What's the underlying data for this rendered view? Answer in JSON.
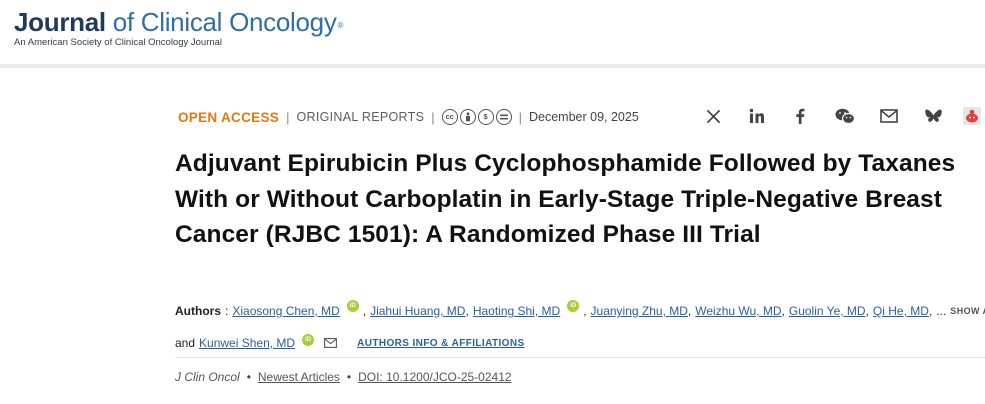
{
  "header": {
    "logo_journal": "Journal",
    "logo_rest": "of Clinical Oncology",
    "logo_mark": "®",
    "logo_subtitle": "An American Society of Clinical Oncology Journal"
  },
  "meta": {
    "access_label": "OPEN ACCESS",
    "section_label": "ORIGINAL REPORTS",
    "license_icons": [
      "cc",
      "by",
      "nc",
      "nd"
    ],
    "date": "December 09, 2025"
  },
  "share_icons": [
    "x-icon",
    "linkedin-icon",
    "facebook-icon",
    "wechat-icon",
    "email-icon",
    "bluesky-icon",
    "reddit-icon"
  ],
  "article": {
    "title": "Adjuvant Epirubicin Plus Cyclophosphamide Followed by Taxanes With or Without Carboplatin in Early-Stage Triple-Negative Breast Cancer (RJBC 1501): A Randomized Phase III Trial"
  },
  "authors": {
    "label": "Authors",
    "list": [
      "Xiaosong Chen, MD",
      "Jiahui Huang, MD",
      "Haoting Shi, MD",
      "Juanying Zhu, MD",
      "Weizhu Wu, MD",
      "Guolin Ye, MD",
      "Qi He, MD"
    ],
    "ellipsis": "...",
    "show_all": "SHOW ALL",
    "trailing": "...",
    "and_label": "and",
    "last_author": "Kunwei Shen, MD",
    "affiliations_link": "AUTHORS INFO & AFFILIATIONS"
  },
  "citation": {
    "journal": "J Clin Oncol",
    "section": "Newest Articles",
    "doi": "DOI: 10.1200/JCO-25-02412"
  },
  "colors": {
    "brand_dark": "#1f3b5c",
    "brand_blue": "#2f6fa3",
    "open_access": "#e07a10",
    "link": "#2a5f9e",
    "orcid": "#a6ce39"
  }
}
